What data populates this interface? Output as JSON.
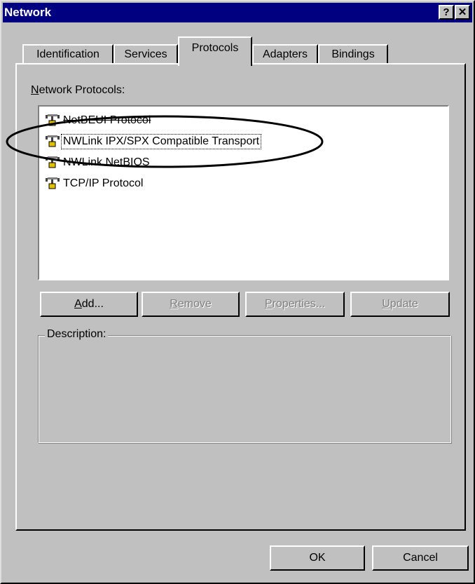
{
  "window": {
    "title": "Network",
    "help_glyph": "?",
    "close_glyph": "✕"
  },
  "tabs": [
    {
      "label": "Identification",
      "active": false
    },
    {
      "label": "Services",
      "active": false
    },
    {
      "label": "Protocols",
      "active": true
    },
    {
      "label": "Adapters",
      "active": false
    },
    {
      "label": "Bindings",
      "active": false
    }
  ],
  "protocols": {
    "label_prefix": "N",
    "label_rest": "etwork Protocols:",
    "items": [
      {
        "label": "NetBEUI Protocol",
        "icon": "network-protocol-icon",
        "struck": true
      },
      {
        "label": "NWLink IPX/SPX Compatible Transport",
        "icon": "network-protocol-icon",
        "focused": true
      },
      {
        "label": "NWLink NetBIOS",
        "icon": "network-protocol-icon"
      },
      {
        "label": "TCP/IP Protocol",
        "icon": "network-protocol-icon"
      }
    ]
  },
  "buttons": {
    "add_u": "A",
    "add_rest": "dd...",
    "remove_u": "R",
    "remove_rest": "emove",
    "properties_u": "P",
    "properties_rest": "roperties...",
    "update_u": "U",
    "update_rest": "pdate",
    "ok": "OK",
    "cancel": "Cancel"
  },
  "description": {
    "label": "Description:",
    "text": ""
  },
  "colors": {
    "titlebar": "#000080",
    "face": "#c0c0c0"
  }
}
